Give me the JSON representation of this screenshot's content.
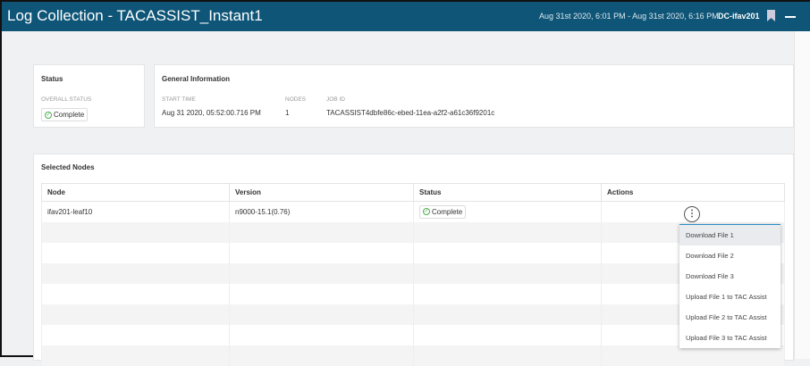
{
  "header": {
    "title": "Log Collection - TACASSIST_Instant1",
    "time_range": "Aug 31st 2020, 6:01 PM - Aug 31st 2020, 6:16 PM",
    "site": "DC-ifav201"
  },
  "status_card": {
    "title": "Status",
    "overall_label": "OVERALL STATUS",
    "overall_value": "Complete"
  },
  "general": {
    "title": "General Information",
    "start_label": "START TIME",
    "start_value": "Aug 31 2020, 05:52:00.716 PM",
    "nodes_label": "NODES",
    "nodes_value": "1",
    "job_label": "JOB ID",
    "job_value": "TACASSIST4dbfe86c-ebed-11ea-a2f2-a61c36f9201c"
  },
  "nodes": {
    "title": "Selected Nodes",
    "columns": [
      "Node",
      "Version",
      "Status",
      "Actions"
    ],
    "rows": [
      {
        "node": "ifav201-leaf10",
        "version": "n9000-15.1(0.76)",
        "status": "Complete"
      }
    ]
  },
  "menu": {
    "items": [
      "Download File 1",
      "Download File 2",
      "Download File 3",
      "Upload File 1 to TAC Assist",
      "Upload File 2 to TAC Assist",
      "Upload File 3 to TAC Assist"
    ]
  }
}
